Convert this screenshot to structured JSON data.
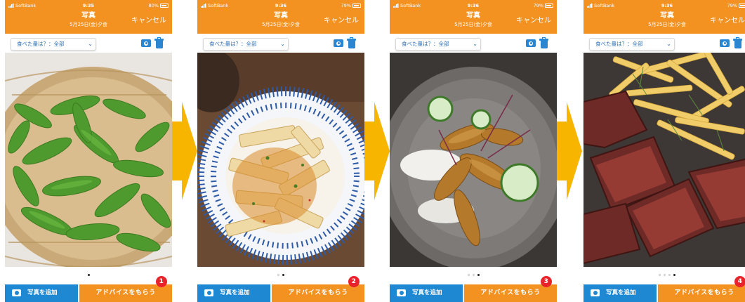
{
  "carrier": "SoftBank",
  "title": "写真",
  "cancel_label": "キャンセル",
  "amount_selector": "食べた量は？：全部",
  "add_photo_label": "写真を追加",
  "advice_label": "アドバイスをもらう",
  "colors": {
    "accent": "#f39221",
    "blue": "#1e88d3",
    "badge": "#e8232b",
    "arrow": "#f7b500"
  },
  "screens": [
    {
      "time": "9:35",
      "battery": "80%",
      "subtitle": "5月25日(金)夕食",
      "badge": "1",
      "photo": "edamame",
      "pages": 1,
      "active_page": 1
    },
    {
      "time": "9:36",
      "battery": "79%",
      "subtitle": "5月25日(金)夕食",
      "badge": "2",
      "photo": "bamboo-shoots",
      "pages": 2,
      "active_page": 2
    },
    {
      "time": "9:36",
      "battery": "79%",
      "subtitle": "5月25日(金)夕食",
      "badge": "3",
      "photo": "fried-fish",
      "pages": 3,
      "active_page": 3
    },
    {
      "time": "9:36",
      "battery": "79%",
      "subtitle": "5月25日(金)夕食",
      "badge": "4",
      "photo": "steak-fries",
      "pages": 4,
      "active_page": 4
    }
  ]
}
